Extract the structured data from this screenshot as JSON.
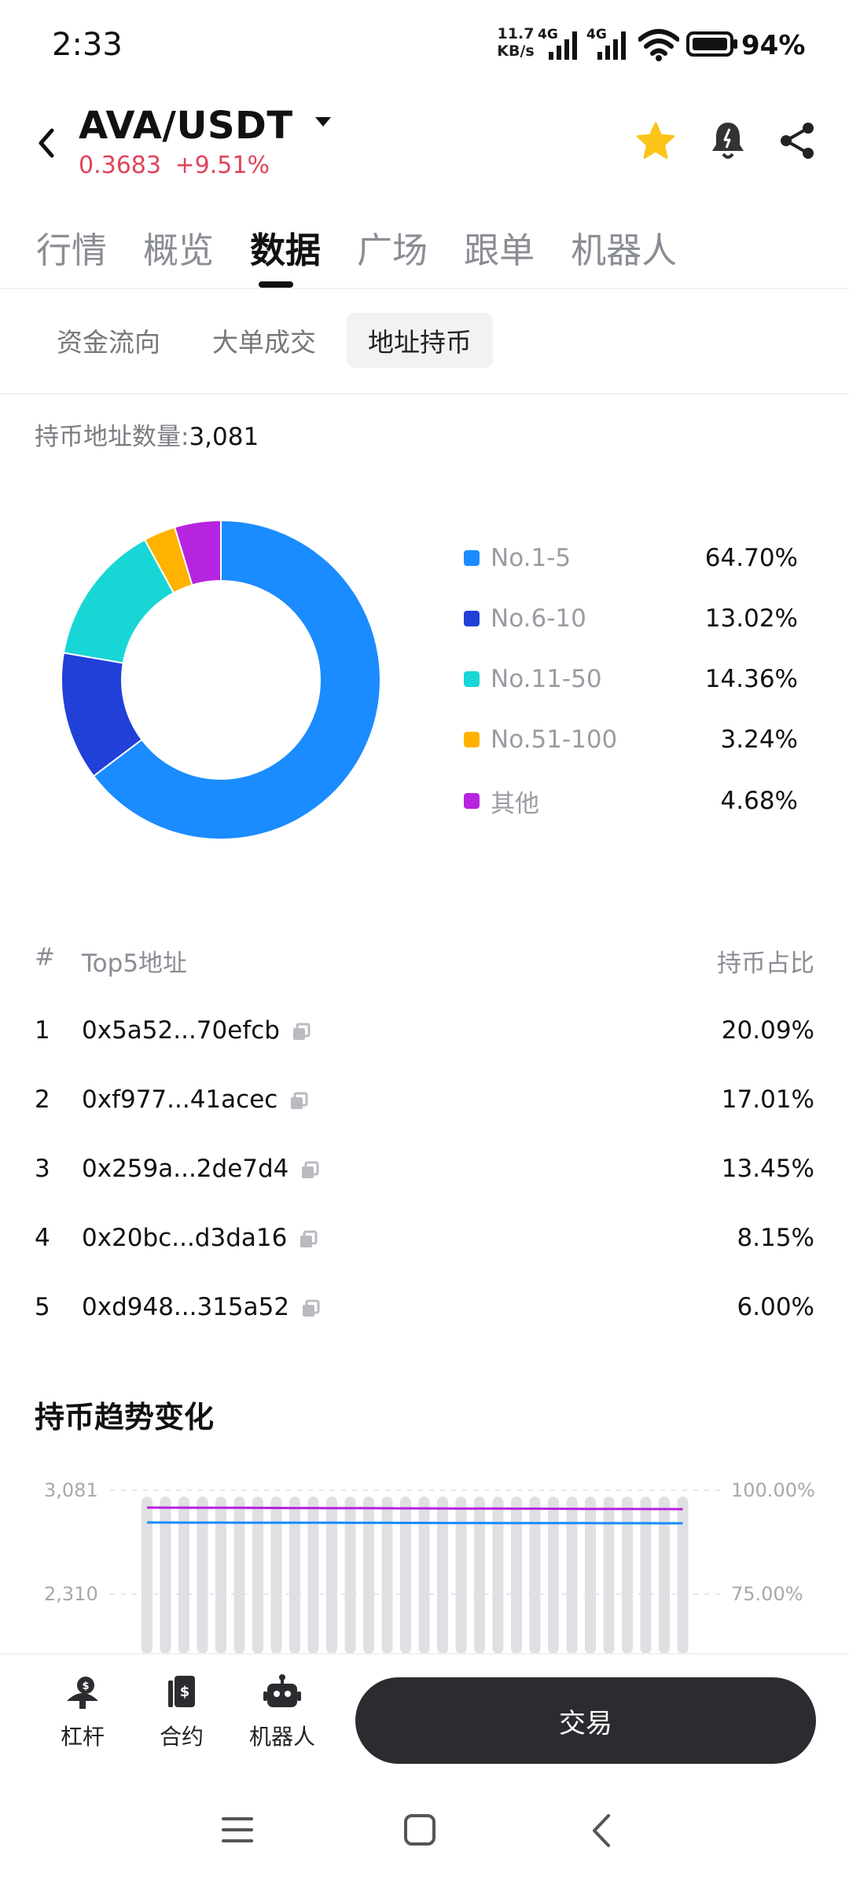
{
  "status": {
    "time": "2:33",
    "net_speed_value": "11.7",
    "net_speed_unit": "KB/s",
    "sim1_label": "4G",
    "sim2_label": "4G",
    "battery_pct": "94%"
  },
  "header": {
    "pair": "AVA/USDT",
    "price": "0.3683",
    "change": "+9.51%",
    "price_color": "#e0435a",
    "favorite_color": "#fcc419"
  },
  "tabs": [
    "行情",
    "概览",
    "数据",
    "广场",
    "跟单",
    "机器人"
  ],
  "active_tab": "数据",
  "subtabs": [
    "资金流向",
    "大单成交",
    "地址持币"
  ],
  "active_subtab": "地址持币",
  "holders": {
    "label": "持币地址数量:",
    "value": "3,081"
  },
  "distribution": [
    {
      "label": "No.1-5",
      "value": "64.70%",
      "pct": 64.7,
      "color": "#1a8cff"
    },
    {
      "label": "No.6-10",
      "value": "13.02%",
      "pct": 13.02,
      "color": "#2140d8"
    },
    {
      "label": "No.11-50",
      "value": "14.36%",
      "pct": 14.36,
      "color": "#19d6d6"
    },
    {
      "label": "No.51-100",
      "value": "3.24%",
      "pct": 3.24,
      "color": "#ffb300"
    },
    {
      "label": "其他",
      "value": "4.68%",
      "pct": 4.68,
      "color": "#b624e0"
    }
  ],
  "top5": {
    "header_index": "#",
    "header_address": "Top5地址",
    "header_share": "持币占比",
    "rows": [
      {
        "index": "1",
        "address": "0x5a52...70efcb",
        "share": "20.09%"
      },
      {
        "index": "2",
        "address": "0xf977...41acec",
        "share": "17.01%"
      },
      {
        "index": "3",
        "address": "0x259a...2de7d4",
        "share": "13.45%"
      },
      {
        "index": "4",
        "address": "0x20bc...d3da16",
        "share": "8.15%"
      },
      {
        "index": "5",
        "address": "0xd948...315a52",
        "share": "6.00%"
      }
    ]
  },
  "trend": {
    "title": "持币趋势变化",
    "left_ticks": [
      "3,081",
      "2,310"
    ],
    "right_ticks": [
      "100.00%",
      "75.00%"
    ],
    "bar_count": 30,
    "bar_color": "#dfe0e3",
    "line_colors": [
      "#b624e0",
      "#1a8cff"
    ]
  },
  "bottom_nav": {
    "leverage": "杠杆",
    "contract": "合约",
    "bot": "机器人",
    "trade": "交易"
  }
}
